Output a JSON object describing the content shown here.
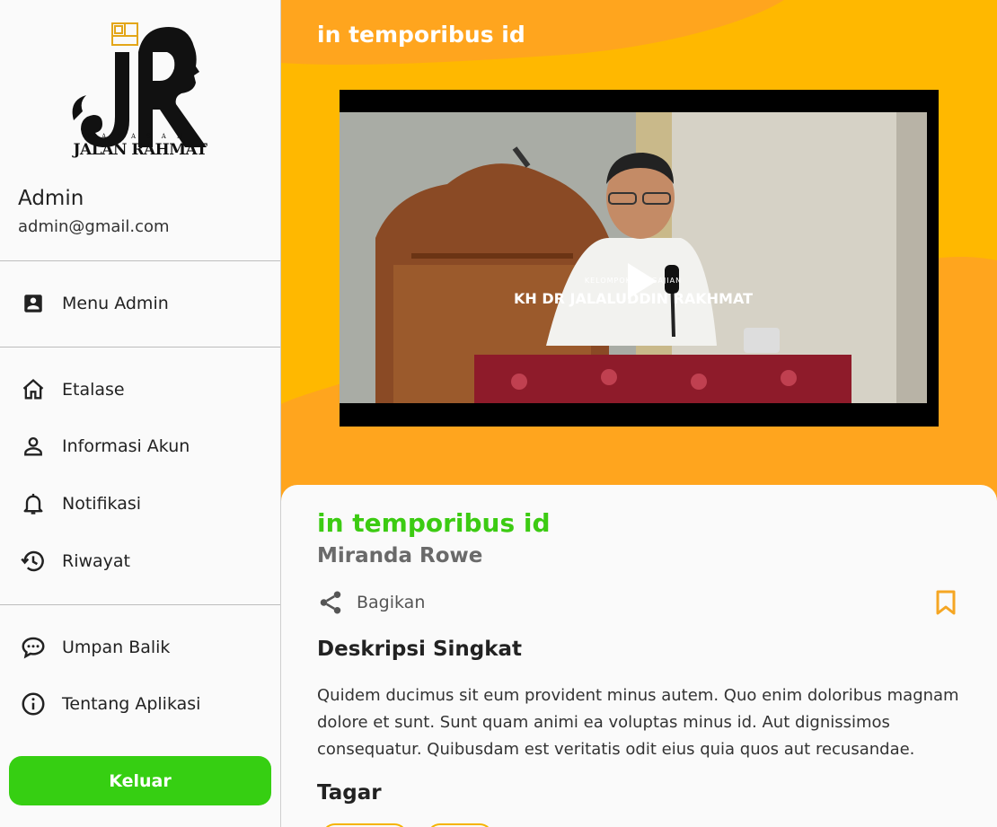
{
  "sidebar": {
    "logo_text": "JALAN RAHMAT",
    "logo_subtext": "YAYASAN",
    "user": {
      "name": "Admin",
      "email": "admin@gmail.com"
    },
    "admin_item": {
      "label": "Menu Admin",
      "icon": "account-box-icon"
    },
    "items": [
      {
        "label": "Etalase",
        "icon": "home-icon"
      },
      {
        "label": "Informasi Akun",
        "icon": "person-icon"
      },
      {
        "label": "Notifikasi",
        "icon": "bell-icon"
      },
      {
        "label": "Riwayat",
        "icon": "history-icon"
      }
    ],
    "extra_items": [
      {
        "label": "Umpan Balik",
        "icon": "chat-bubble-icon"
      },
      {
        "label": "Tentang Aplikasi",
        "icon": "info-icon"
      }
    ],
    "logout_label": "Keluar"
  },
  "header": {
    "title": "in temporibus id"
  },
  "video": {
    "caption_small": "KELOMPOK PENGAJIAN",
    "caption": "KH DR JALALUDDIN RAKHMAT"
  },
  "content": {
    "title": "in temporibus id",
    "author": "Miranda Rowe",
    "share_label": "Bagikan",
    "description_heading": "Deskripsi Singkat",
    "description": "Quidem ducimus sit eum provident minus autem. Quo enim doloribus magnam dolore et sunt. Sunt quam animi ea voluptas minus id. Aut dignissimos consequatur. Quibusdam est veritatis odit eius quia quos aut recusandae.",
    "tags_heading": "Tagar"
  },
  "colors": {
    "accent_green": "#36cf12",
    "title_green": "#3ccb12",
    "header_yellow": "#ffb800",
    "header_orange": "#ffa51e",
    "bookmark_orange": "#f5a623"
  }
}
